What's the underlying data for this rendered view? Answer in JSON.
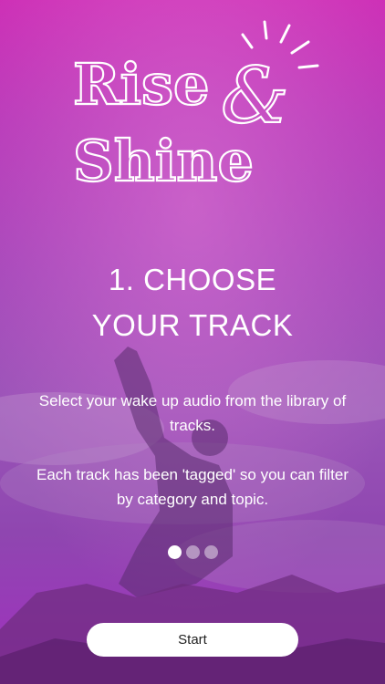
{
  "logo": {
    "line1": "Rise",
    "ampersand": "&",
    "line2": "Shine"
  },
  "slide": {
    "title_line1": "1. CHOOSE",
    "title_line2": "YOUR TRACK",
    "paragraph1": "Select your wake up audio from the library of tracks.",
    "paragraph2": "Each track has been 'tagged' so you can filter by category and topic."
  },
  "pager": {
    "total": 3,
    "active_index": 0
  },
  "start_button": {
    "label": "Start"
  },
  "colors": {
    "primary_overlay": "#b43cb8",
    "text": "#ffffff",
    "button_bg": "#ffffff",
    "button_text": "#222222"
  }
}
